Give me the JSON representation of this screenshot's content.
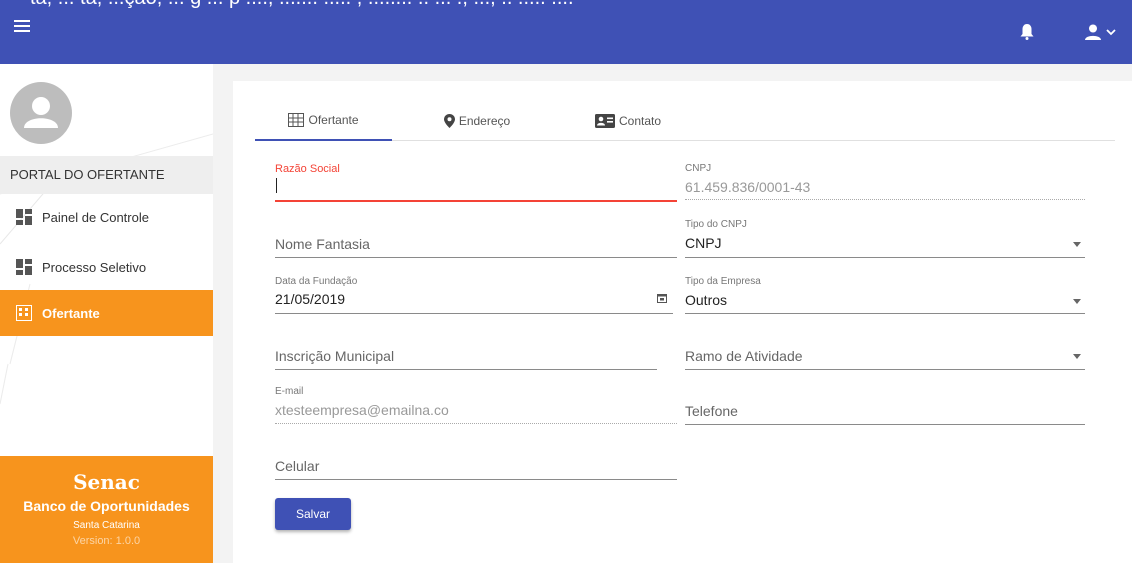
{
  "topbar": {
    "overflow_text": "ta, ... ta, ...ção, ... g ... p ...., ....... ..... , ........ .. ... ., ..., .. ..... ....",
    "colors": {
      "bar": "#3f51b5"
    }
  },
  "sidebar": {
    "portal_title": "PORTAL DO OFERTANTE",
    "items": [
      {
        "label": "Painel de Controle",
        "icon": "dashboard-icon"
      },
      {
        "label": "Processo Seletivo",
        "icon": "dashboard-icon"
      },
      {
        "label": "Ofertante",
        "icon": "building-icon",
        "active": true
      }
    ],
    "footer": {
      "logo": "Senac",
      "bank": "Banco de Oportunidades",
      "state": "Santa Catarina",
      "version": "Version: 1.0.0"
    },
    "colors": {
      "accent": "#f7941d"
    }
  },
  "tabs": [
    {
      "label": "Ofertante",
      "icon": "building-icon",
      "active": true
    },
    {
      "label": "Endereço",
      "icon": "location-pin-icon"
    },
    {
      "label": "Contato",
      "icon": "contact-card-icon"
    }
  ],
  "form": {
    "razao_social": {
      "label": "Razão Social",
      "value": ""
    },
    "cnpj": {
      "label": "CNPJ",
      "value": "61.459.836/0001-43"
    },
    "nome_fantasia": {
      "placeholder": "Nome Fantasia"
    },
    "tipo_cnpj": {
      "label": "Tipo do CNPJ",
      "value": "CNPJ"
    },
    "data_fundacao": {
      "label": "Data da Fundação",
      "value": "21/05/2019"
    },
    "tipo_empresa": {
      "label": "Tipo da Empresa",
      "value": "Outros"
    },
    "inscricao_municipal": {
      "placeholder": "Inscrição Municipal"
    },
    "ramo_atividade": {
      "placeholder": "Ramo de Atividade"
    },
    "email": {
      "label": "E-mail",
      "value": "xtesteempresa@emailna.co"
    },
    "telefone": {
      "placeholder": "Telefone"
    },
    "celular": {
      "placeholder": "Celular"
    },
    "save_label": "Salvar"
  }
}
